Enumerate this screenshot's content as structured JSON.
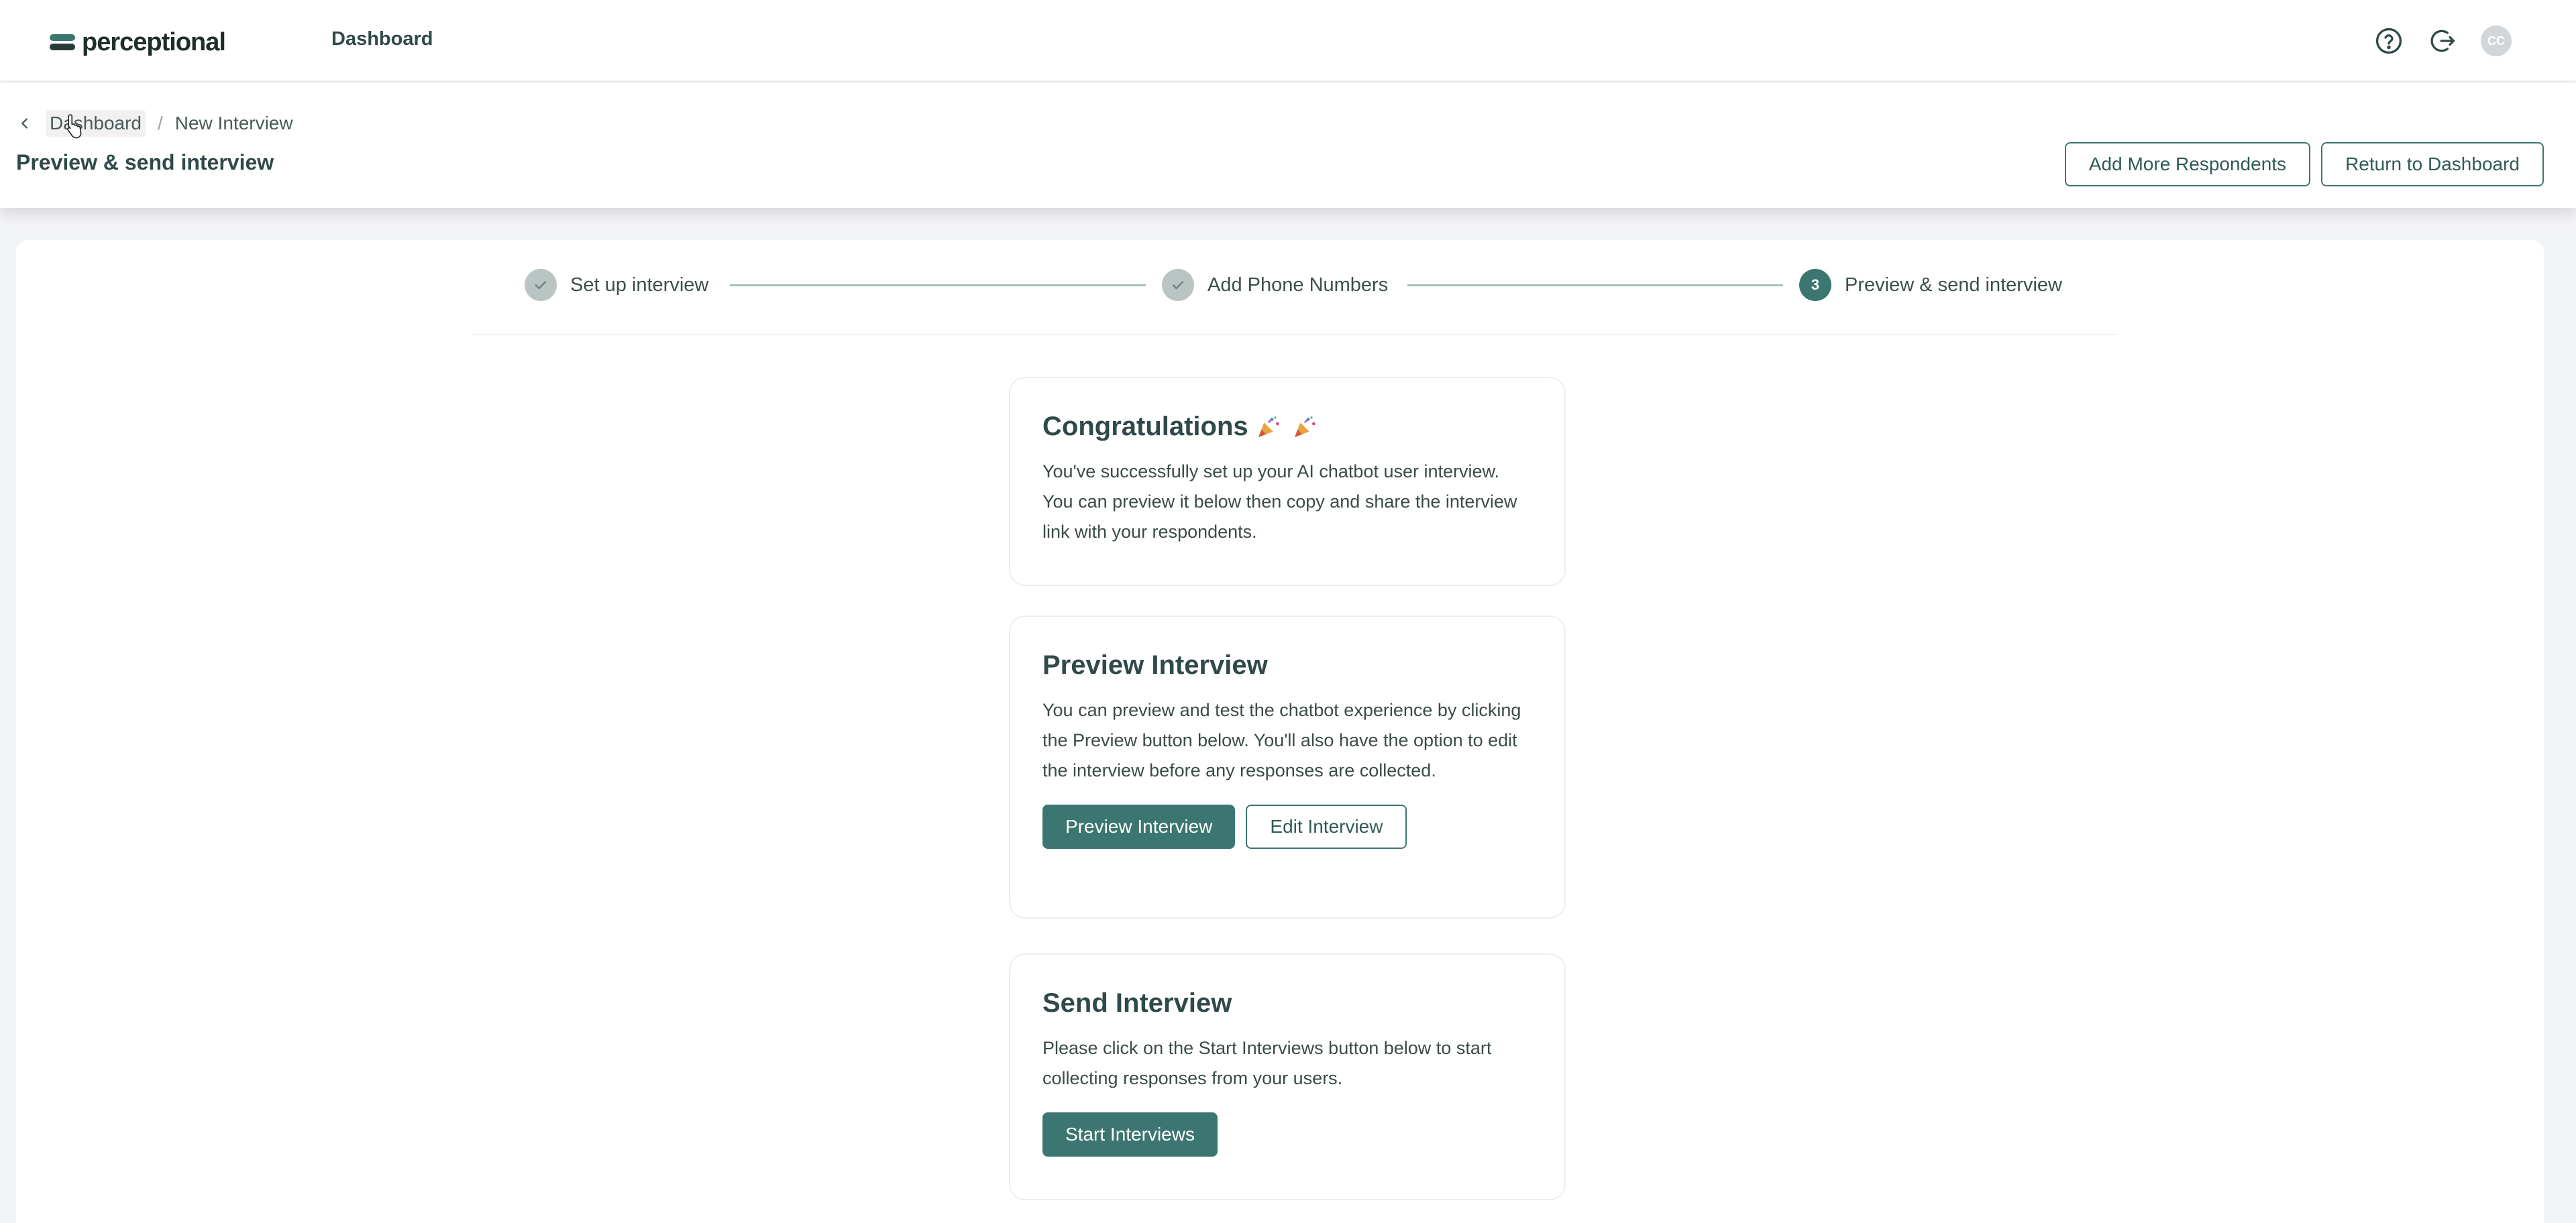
{
  "app": {
    "logo_text": "perceptional",
    "nav_dashboard": "Dashboard",
    "avatar_initials": "CC"
  },
  "breadcrumb": {
    "parent": "Dashboard",
    "separator": "/",
    "current": "New Interview"
  },
  "page_title": "Preview & send interview",
  "header_actions": {
    "add_more": "Add More Respondents",
    "return": "Return to Dashboard"
  },
  "stepper": {
    "steps": [
      {
        "label": "Set up interview",
        "state": "done",
        "marker": ""
      },
      {
        "label": "Add Phone Numbers",
        "state": "done",
        "marker": ""
      },
      {
        "label": "Preview & send interview",
        "state": "active",
        "marker": "3"
      }
    ]
  },
  "congrats_card": {
    "title": "Congratulations",
    "body": "You've successfully set up your AI chatbot user interview. You can preview it below then copy and share the interview link with your respondents."
  },
  "preview_card": {
    "title": "Preview Interview",
    "body": "You can preview and test the chatbot experience by clicking the Preview button below. You'll also have the option to edit the interview before any responses are collected.",
    "primary_button": "Preview Interview",
    "secondary_button": "Edit Interview"
  },
  "send_card": {
    "title": "Send Interview",
    "body": "Please click on the Start Interviews button below to start collecting responses from your users.",
    "primary_button": "Start Interviews"
  },
  "colors": {
    "accent": "#3c7670",
    "text": "#2f4a48",
    "background": "#f2f3f6",
    "step_done": "#b9c4c3"
  },
  "icons": {
    "help": "question-circle-icon",
    "logout": "logout-icon",
    "back": "chevron-left-icon",
    "done_check": "check-icon",
    "party": "party-popper-icon"
  }
}
